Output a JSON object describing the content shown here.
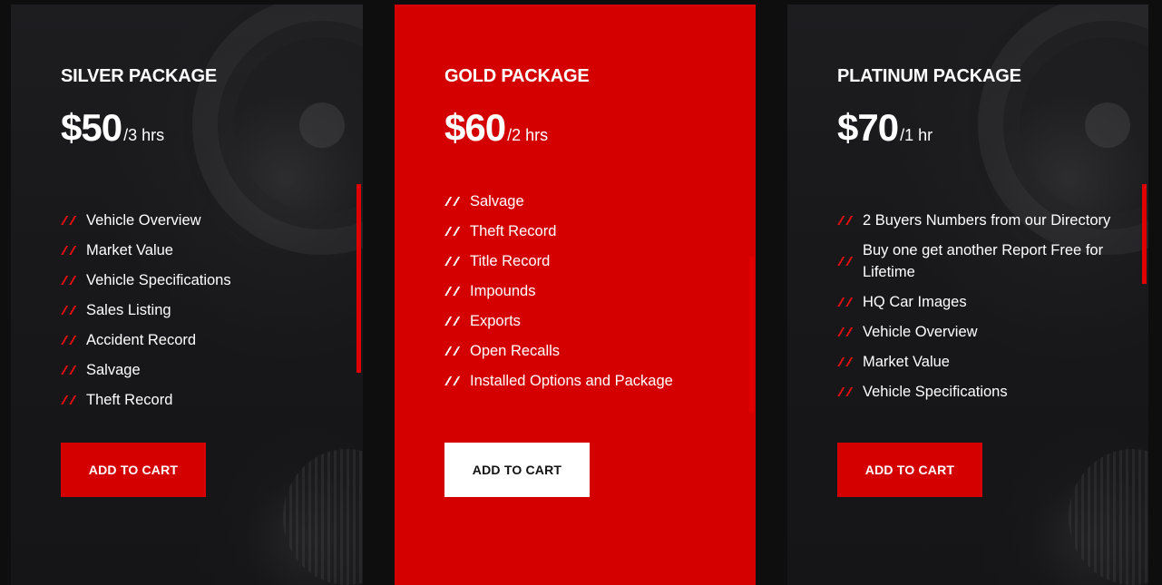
{
  "colors": {
    "accent": "#d40000",
    "page_background": "#0e0e0f",
    "card_dark": "#1b1b1d",
    "text": "#ffffff"
  },
  "packages": [
    {
      "title": "SILVER PACKAGE",
      "price": "$50",
      "period": "/3 hrs",
      "features": [
        "Vehicle Overview",
        "Market Value",
        "Vehicle Specifications",
        "Sales Listing",
        "Accident Record",
        "Salvage",
        "Theft Record"
      ],
      "button": "ADD TO CART"
    },
    {
      "title": "GOLD PACKAGE",
      "price": "$60",
      "period": "/2 hrs",
      "features": [
        "Salvage",
        "Theft Record",
        "Title Record",
        "Impounds",
        "Exports",
        "Open Recalls",
        "Installed Options and Package"
      ],
      "button": "ADD TO CART"
    },
    {
      "title": "PLATINUM PACKAGE",
      "price": "$70",
      "period": "/1 hr",
      "features": [
        "2 Buyers Numbers from our Directory",
        "Buy one get another Report Free for Lifetime",
        "HQ Car Images",
        "Vehicle Overview",
        "Market Value",
        "Vehicle Specifications"
      ],
      "button": "ADD TO CART"
    }
  ],
  "icons": {
    "feature_bullet": "double-slash-icon"
  }
}
